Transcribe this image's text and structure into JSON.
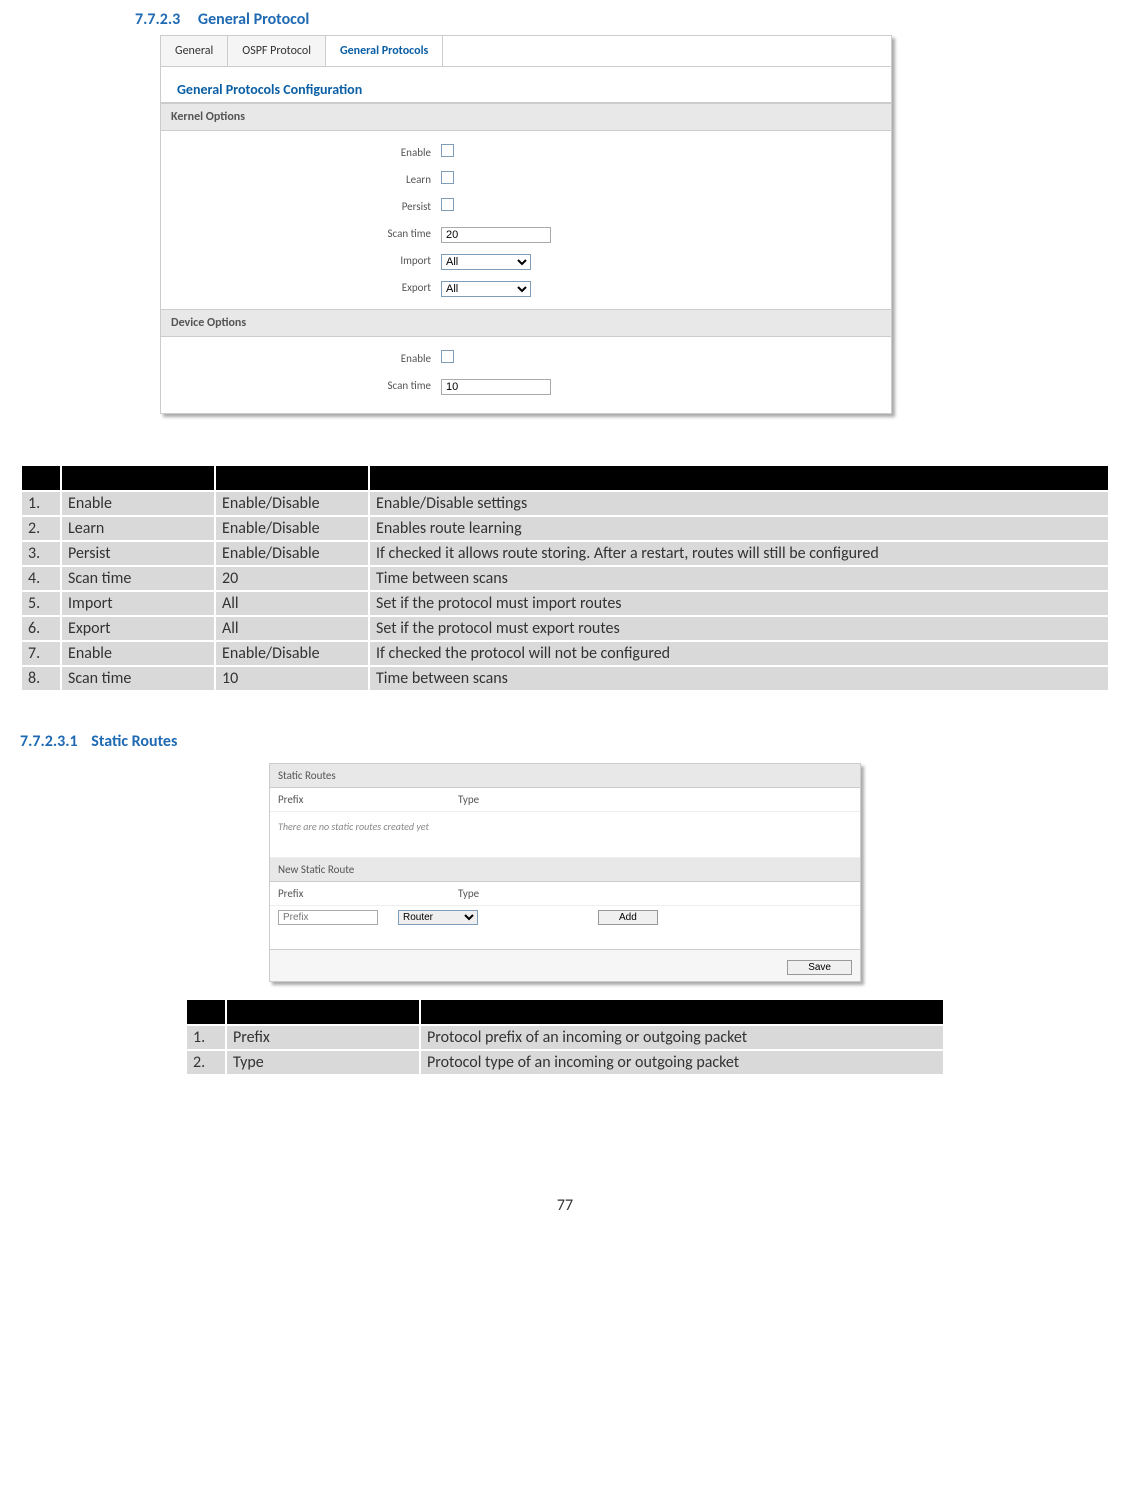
{
  "h1": {
    "num": "7.7.2.3",
    "text": "General Protocol"
  },
  "shot1": {
    "tabs": [
      "General",
      "OSPF Protocol",
      "General Protocols"
    ],
    "active_tab": 2,
    "title": "General Protocols Configuration",
    "sect1": "Kernel Options",
    "kernel": {
      "enable_l": "Enable",
      "learn_l": "Learn",
      "persist_l": "Persist",
      "scan_l": "Scan time",
      "scan_v": "20",
      "import_l": "Import",
      "import_v": "All",
      "export_l": "Export",
      "export_v": "All"
    },
    "sect2": "Device Options",
    "device": {
      "enable_l": "Enable",
      "scan_l": "Scan time",
      "scan_v": "10"
    }
  },
  "table1": [
    {
      "n": "1.",
      "a": "Enable",
      "b": "Enable/Disable",
      "c": "Enable/Disable settings"
    },
    {
      "n": "2.",
      "a": "Learn",
      "b": "Enable/Disable",
      "c": "Enables route learning"
    },
    {
      "n": "3.",
      "a": "Persist",
      "b": "Enable/Disable",
      "c": "If checked it allows route storing. After a restart, routes will still be configured"
    },
    {
      "n": "4.",
      "a": "Scan time",
      "b": "20",
      "c": "Time between scans"
    },
    {
      "n": "5.",
      "a": "Import",
      "b": "All",
      "c": "Set if the protocol must import routes"
    },
    {
      "n": "6.",
      "a": "Export",
      "b": "All",
      "c": "Set if the protocol must export routes"
    },
    {
      "n": "7.",
      "a": "Enable",
      "b": "Enable/Disable",
      "c": "If checked the protocol will not be configured"
    },
    {
      "n": "8.",
      "a": "Scan time",
      "b": "10",
      "c": "Time between scans"
    }
  ],
  "h2": {
    "num": "7.7.2.3.1",
    "text": "Static Routes"
  },
  "shot2": {
    "head1": "Static Routes",
    "col1": "Prefix",
    "col2": "Type",
    "empty": "There are no static routes created yet",
    "head2": "New Static Route",
    "prefix_ph": "Prefix",
    "type_v": "Router",
    "add": "Add",
    "save": "Save"
  },
  "table2": [
    {
      "n": "1.",
      "a": "Prefix",
      "c": "Protocol prefix of an incoming or outgoing packet"
    },
    {
      "n": "2.",
      "a": "Type",
      "c": "Protocol type of an incoming or outgoing packet"
    }
  ],
  "page": "77"
}
